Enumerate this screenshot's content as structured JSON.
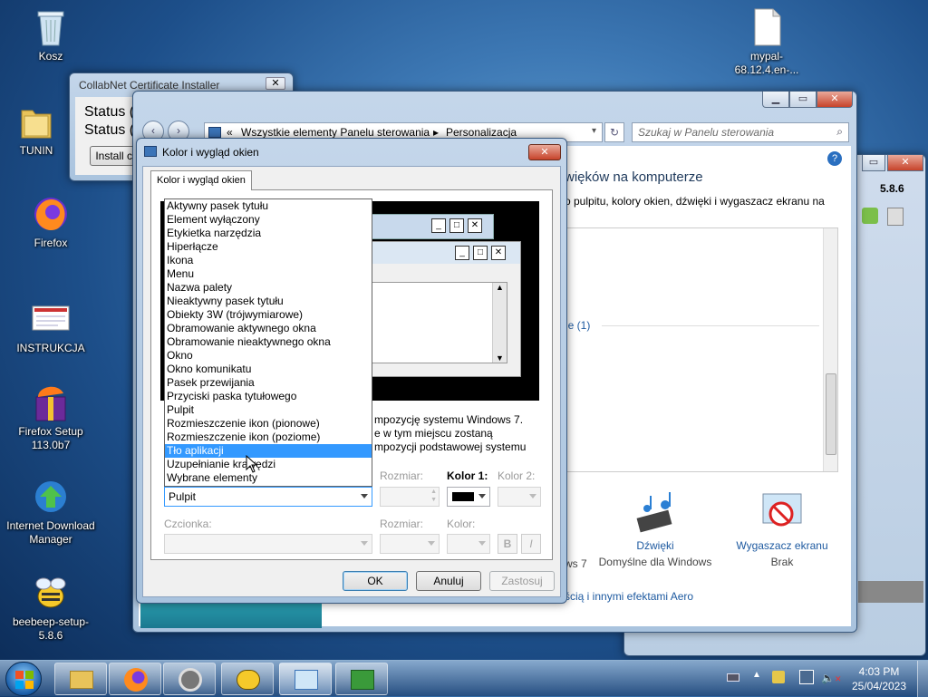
{
  "desktop": {
    "icons": [
      {
        "label": "Kosz",
        "icon": "recycle-bin-icon"
      },
      {
        "label": "TUNIN",
        "icon": "folder-icon"
      },
      {
        "label": "Firefox",
        "icon": "firefox-icon"
      },
      {
        "label": "INSTRUKCJA",
        "icon": "document-icon"
      },
      {
        "label": "Firefox Setup 113.0b7",
        "icon": "firefox-setup-icon"
      },
      {
        "label": "Internet Download Manager",
        "icon": "idm-icon"
      },
      {
        "label": "beebeep-setup-5.8.6",
        "icon": "beebeep-icon"
      },
      {
        "label": "mypal-68.12.4.en-...",
        "icon": "file-icon"
      }
    ]
  },
  "collabnet": {
    "title": "CollabNet Certificate Installer",
    "status1": "Status (",
    "status2": "Status (",
    "install_button": "Install ce"
  },
  "beebeep": {
    "version": "5.8.6"
  },
  "control_panel": {
    "breadcrumb_root": "Wszystkie elementy Panelu sterowania",
    "breadcrumb_current": "Personalizacja",
    "breadcrumb_sep": "▸",
    "breadcrumb_prefix": "«",
    "search_placeholder": "Szukaj w Panelu sterowania",
    "heading_partial": "więków na komputerze",
    "desc_partial": "o pulpitu, kolory okien, dźwięki i wygaszacz ekranu na",
    "theme_group_partial": "ie (1)",
    "bottom_items": [
      {
        "title": "Dźwięki",
        "sub": "Domyślne dla Windows",
        "icon": "sounds-icon"
      },
      {
        "title": "Wygaszacz ekranu",
        "sub": "Brak",
        "icon": "screensaver-icon"
      }
    ],
    "ws7_partial": "ws 7",
    "aero_link_partial": "ścią i innymi efektami Aero"
  },
  "dialog": {
    "title": "Kolor i wygląd okien",
    "tab": "Kolor i wygląd okien",
    "info_line1": "mpozycję systemu Windows 7.",
    "info_line2": "e w tym miejscu zostaną",
    "info_line3": "mpozycji podstawowej systemu",
    "element_selected": "Pulpit",
    "list_items": [
      "Aktywny pasek tytułu",
      "Element wyłączony",
      "Etykietka narzędzia",
      "Hiperłącze",
      "Ikona",
      "Menu",
      "Nazwa palety",
      "Nieaktywny pasek tytułu",
      "Obiekty 3W (trójwymiarowe)",
      "Obramowanie aktywnego okna",
      "Obramowanie nieaktywnego okna",
      "Okno",
      "Okno komunikatu",
      "Pasek przewijania",
      "Przyciski paska tytułowego",
      "Pulpit",
      "Rozmieszczenie ikon (pionowe)",
      "Rozmieszczenie ikon (poziome)",
      "Tło aplikacji",
      "Uzupełnianie krawędzi",
      "Wybrane elementy"
    ],
    "highlighted_index": 18,
    "size_label": "Rozmiar:",
    "color1_label": "Kolor 1:",
    "color2_label": "Kolor 2:",
    "font_label": "Czcionka:",
    "font_size_label": "Rozmiar:",
    "font_color_label": "Kolor:",
    "bold": "B",
    "italic": "I",
    "ok": "OK",
    "cancel": "Anuluj",
    "apply": "Zastosuj",
    "color1_value": "#000000"
  },
  "taskbar": {
    "time": "4:03 PM",
    "date": "25/04/2023"
  }
}
